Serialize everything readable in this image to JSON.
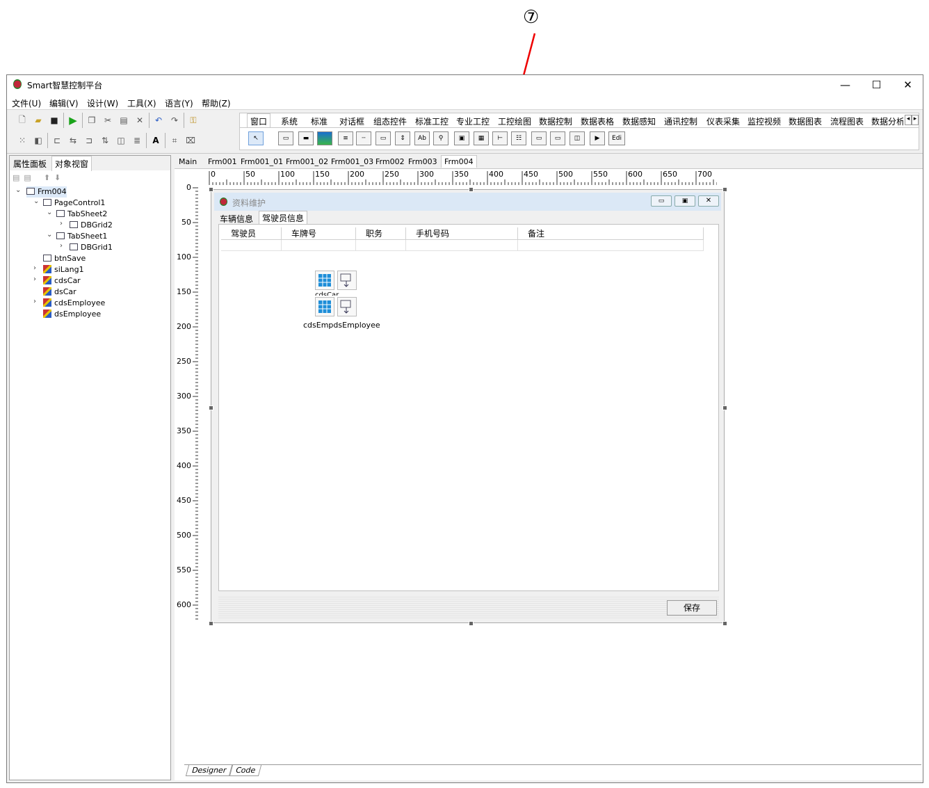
{
  "annotation": {
    "label": "⑦"
  },
  "window": {
    "title": "Smart智慧控制平台",
    "minimize": "—",
    "maximize": "☐",
    "close": "✕"
  },
  "menu": [
    "文件(U)",
    "编辑(V)",
    "设计(W)",
    "工具(X)",
    "语言(Y)",
    "帮助(Z)"
  ],
  "palette_tabs": [
    "窗口",
    "系统",
    "标准",
    "对话框",
    "组态控件",
    "标准工控",
    "专业工控",
    "工控绘图",
    "数据控制",
    "数据表格",
    "数据感知",
    "通讯控制",
    "仪表采集",
    "监控视频",
    "数据图表",
    "流程图表",
    "数据分析"
  ],
  "palette_scroll": [
    "◂",
    "▸"
  ],
  "palette_edit_label": "Edi",
  "left_tabs": [
    "属性面板",
    "对象视窗"
  ],
  "tree": {
    "root": "Frm004",
    "items": [
      {
        "label": "PageControl1",
        "level": 1,
        "icon": "form-icon"
      },
      {
        "label": "TabSheet2",
        "level": 2,
        "icon": "form-icon"
      },
      {
        "label": "DBGrid2",
        "level": 3,
        "icon": "form-icon"
      },
      {
        "label": "TabSheet1",
        "level": 2,
        "icon": "form-icon"
      },
      {
        "label": "DBGrid1",
        "level": 3,
        "icon": "form-icon"
      },
      {
        "label": "btnSave",
        "level": 1,
        "icon": "form-icon"
      },
      {
        "label": "siLang1",
        "level": 1,
        "icon": "component-icon"
      },
      {
        "label": "cdsCar",
        "level": 1,
        "icon": "component-icon"
      },
      {
        "label": "dsCar",
        "level": 1,
        "icon": "component-icon"
      },
      {
        "label": "cdsEmployee",
        "level": 1,
        "icon": "component-icon"
      },
      {
        "label": "dsEmployee",
        "level": 1,
        "icon": "component-icon"
      }
    ]
  },
  "doc_tabs": [
    "Main",
    "Frm001",
    "Frm001_01",
    "Frm001_02",
    "Frm001_03",
    "Frm002",
    "Frm003",
    "Frm004"
  ],
  "active_doc_tab": "Frm004",
  "ruler_h": [
    "0",
    "50",
    "100",
    "150",
    "200",
    "250",
    "300",
    "350",
    "400",
    "450",
    "500",
    "550",
    "600",
    "650",
    "700"
  ],
  "ruler_v": [
    "0",
    "50",
    "100",
    "150",
    "200",
    "250",
    "300",
    "350",
    "400",
    "450",
    "500",
    "550",
    "600"
  ],
  "form": {
    "title": "资料维护",
    "tabs": [
      "车辆信息",
      "驾驶员信息"
    ],
    "columns": [
      "驾驶员",
      "车牌号",
      "职务",
      "手机号码",
      "备注"
    ],
    "comp_label_1": "cdsCar dsCar",
    "comp_label_2": "cdsEmpdsEmployee",
    "save": "保存"
  },
  "bottom_tabs": [
    "Designer",
    "Code"
  ]
}
